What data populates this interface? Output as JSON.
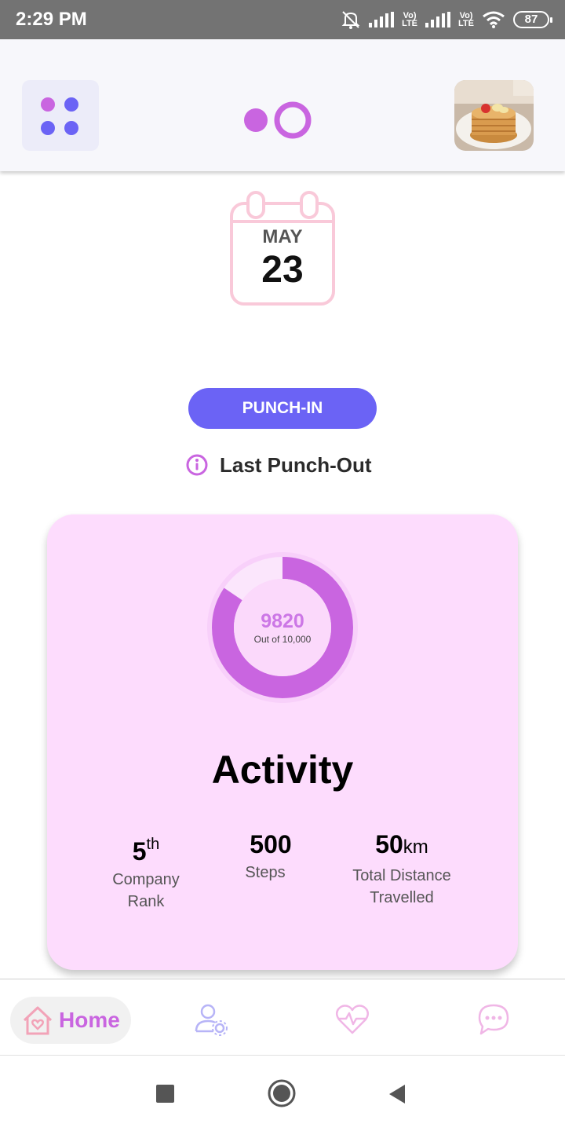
{
  "status_bar": {
    "time": "2:29 PM",
    "battery": "87",
    "lte1": "Vo\nLTE",
    "lte2": "Vo\nLTE"
  },
  "header": {
    "menu_icon": "grid-dots-icon",
    "logo": "two-circles-logo",
    "avatar": "pancake-avatar"
  },
  "calendar": {
    "month": "MAY",
    "day": "23"
  },
  "punch": {
    "button_label": "PUNCH-IN",
    "last_label": "Last Punch-Out"
  },
  "activity": {
    "steps_value": "9820",
    "steps_goal": "Out of 10,000",
    "progress": 0.982,
    "title": "Activity",
    "stats": [
      {
        "value": "5",
        "suffix": "th",
        "label": "Company Rank"
      },
      {
        "value": "500",
        "suffix": "",
        "label": "Steps"
      },
      {
        "value": "50",
        "suffix": "km",
        "label": "Total Distance Travelled"
      }
    ]
  },
  "nav": {
    "home_label": "Home",
    "items": [
      "home-icon",
      "user-settings-icon",
      "heartbeat-icon",
      "chat-icon"
    ]
  },
  "colors": {
    "accent": "#6b63f5",
    "purple": "#c965e0",
    "card_bg": "#fddcfd",
    "calendar_pink": "#f9c9d9"
  }
}
